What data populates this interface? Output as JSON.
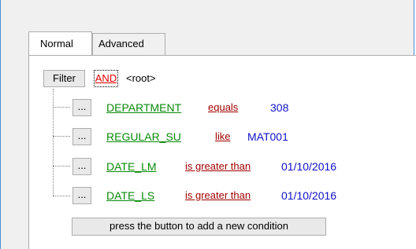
{
  "tabs": [
    {
      "label": "Normal",
      "active": true
    },
    {
      "label": "Advanced",
      "active": false
    }
  ],
  "filter_button": "Filter",
  "logic_operator": "AND",
  "root_label": "<root>",
  "conditions": [
    {
      "button": "...",
      "field": "DEPARTMENT",
      "operator": "equals",
      "value": "308"
    },
    {
      "button": "...",
      "field": "REGULAR_SU",
      "operator": "like",
      "value": "MAT001"
    },
    {
      "button": "...",
      "field": "DATE_LM",
      "operator": "is greater than",
      "value": "01/10/2016"
    },
    {
      "button": "...",
      "field": "DATE_LS",
      "operator": "is greater than",
      "value": "01/10/2016"
    }
  ],
  "add_condition_button": "press the button to add a new condition",
  "colors": {
    "field": "#0a8a0a",
    "operator": "#a00000",
    "value": "#1010c8",
    "logic": "#e00000",
    "window_border": "#4a8fd8"
  }
}
